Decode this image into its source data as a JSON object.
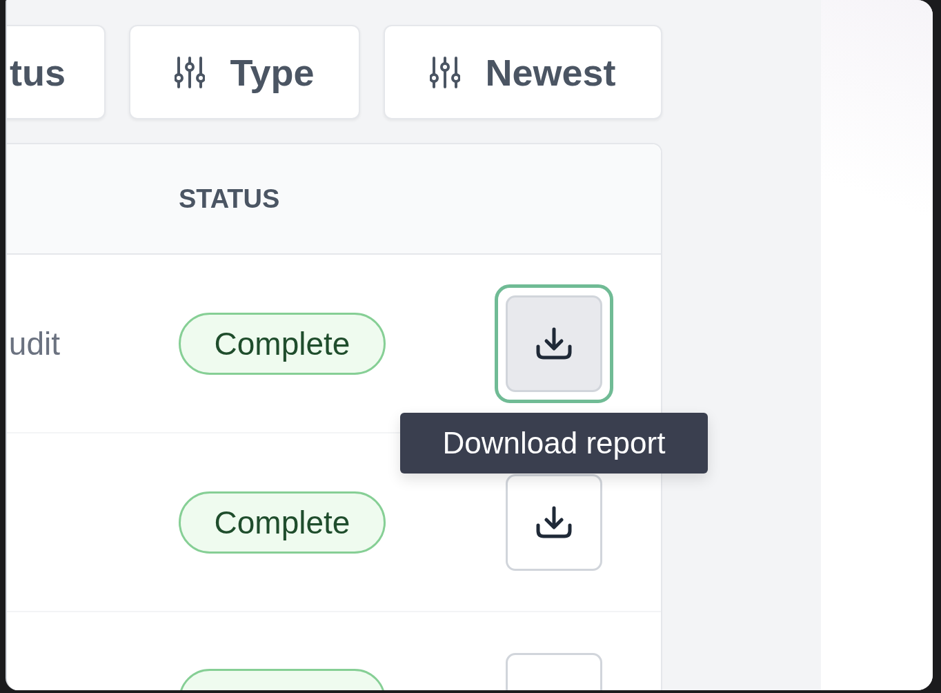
{
  "filters": [
    {
      "label": "tus"
    },
    {
      "label": "Type"
    },
    {
      "label": "Newest"
    }
  ],
  "table": {
    "columns": [
      "STATUS"
    ],
    "rows": [
      {
        "name": "udit",
        "status": "Complete",
        "focused": true
      },
      {
        "status": "Complete",
        "focused": false
      },
      {
        "focused": false
      }
    ]
  },
  "tooltip": "Download report"
}
